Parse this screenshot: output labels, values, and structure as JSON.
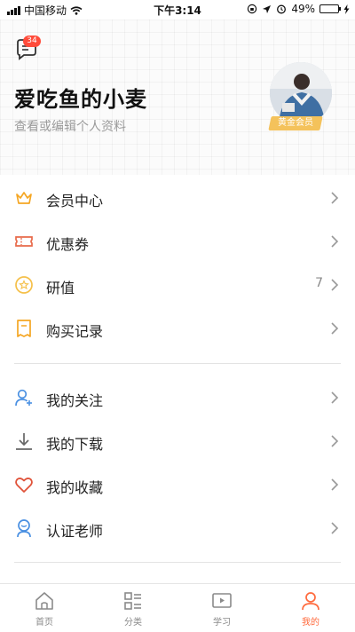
{
  "status_bar": {
    "carrier": "中国移动",
    "time": "下午3:14",
    "battery": "49%",
    "battery_level": 0.49
  },
  "header": {
    "message_badge": "34",
    "username": "爱吃鱼的小麦",
    "edit_hint": "查看或编辑个人资料",
    "vip_label": "黄金会员"
  },
  "menu_group_1": [
    {
      "label": "会员中心",
      "icon": "crown-icon"
    },
    {
      "label": "优惠券",
      "icon": "ticket-icon"
    },
    {
      "label": "研值",
      "icon": "star-coin-icon",
      "count": "7"
    },
    {
      "label": "购买记录",
      "icon": "receipt-icon"
    }
  ],
  "menu_group_2": [
    {
      "label": "我的关注",
      "icon": "user-plus-icon"
    },
    {
      "label": "我的下载",
      "icon": "download-icon"
    },
    {
      "label": "我的收藏",
      "icon": "heart-icon"
    },
    {
      "label": "认证老师",
      "icon": "teacher-icon"
    }
  ],
  "tabs": [
    {
      "label": "首页",
      "icon": "home-icon"
    },
    {
      "label": "分类",
      "icon": "category-icon"
    },
    {
      "label": "学习",
      "icon": "play-icon"
    },
    {
      "label": "我的",
      "icon": "profile-icon",
      "active": true
    }
  ],
  "colors": {
    "accent": "#ff6a3d",
    "badge": "#ff4b3a",
    "vip": "#f4c25b",
    "crown": "#f5a623",
    "ticket": "#e86a4a",
    "blue_icon": "#4a90e2"
  }
}
